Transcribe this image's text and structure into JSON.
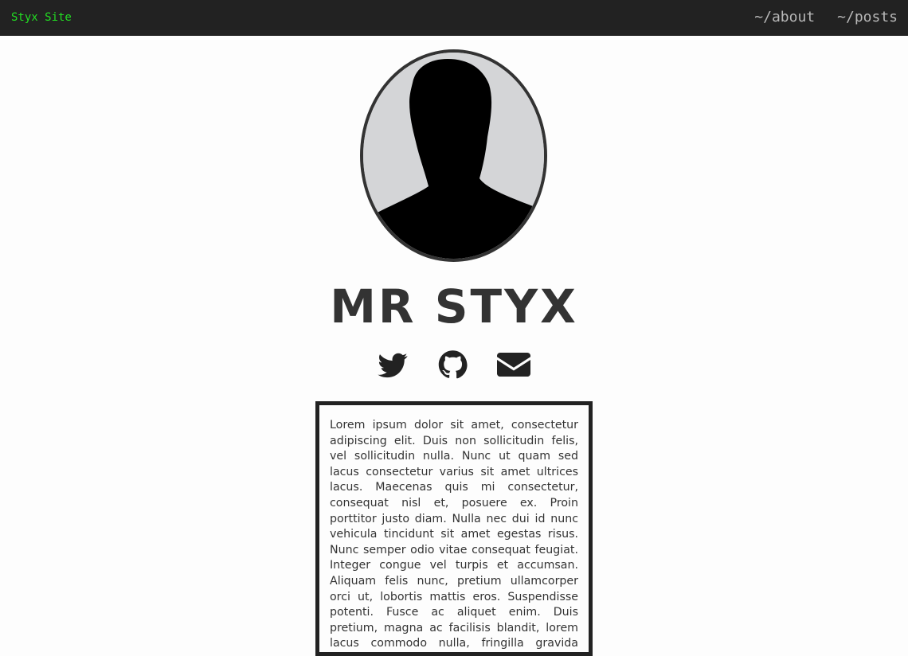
{
  "navbar": {
    "brand": "Styx Site",
    "links": [
      {
        "label": "~/about"
      },
      {
        "label": "~/posts"
      }
    ]
  },
  "profile": {
    "name": "MR STYX",
    "social_icons": [
      "twitter-icon",
      "github-icon",
      "mail-icon"
    ]
  },
  "bio": {
    "text": "Lorem ipsum dolor sit amet, consectetur adipiscing elit. Duis non sollicitudin felis, vel sollicitudin nulla. Nunc ut quam sed lacus consectetur varius sit amet ultrices lacus. Maecenas quis mi consectetur, consequat nisl et, posuere ex. Proin porttitor justo diam. Nulla nec dui id nunc vehicula tincidunt sit amet egestas risus. Nunc semper odio vitae consequat feugiat. Integer congue vel turpis et accumsan. Aliquam felis nunc, pretium ullamcorper orci ut, lobortis mattis eros. Suspendisse potenti. Fusce ac aliquet enim. Duis pretium, magna ac facilisis blandit, lorem lacus commodo nulla, fringilla gravida magna"
  },
  "colors": {
    "navbar_bg": "#222222",
    "brand": "#22dd22",
    "nav_link": "#b8b8b8",
    "page_bg": "#fdfdfd",
    "text": "#333333"
  }
}
